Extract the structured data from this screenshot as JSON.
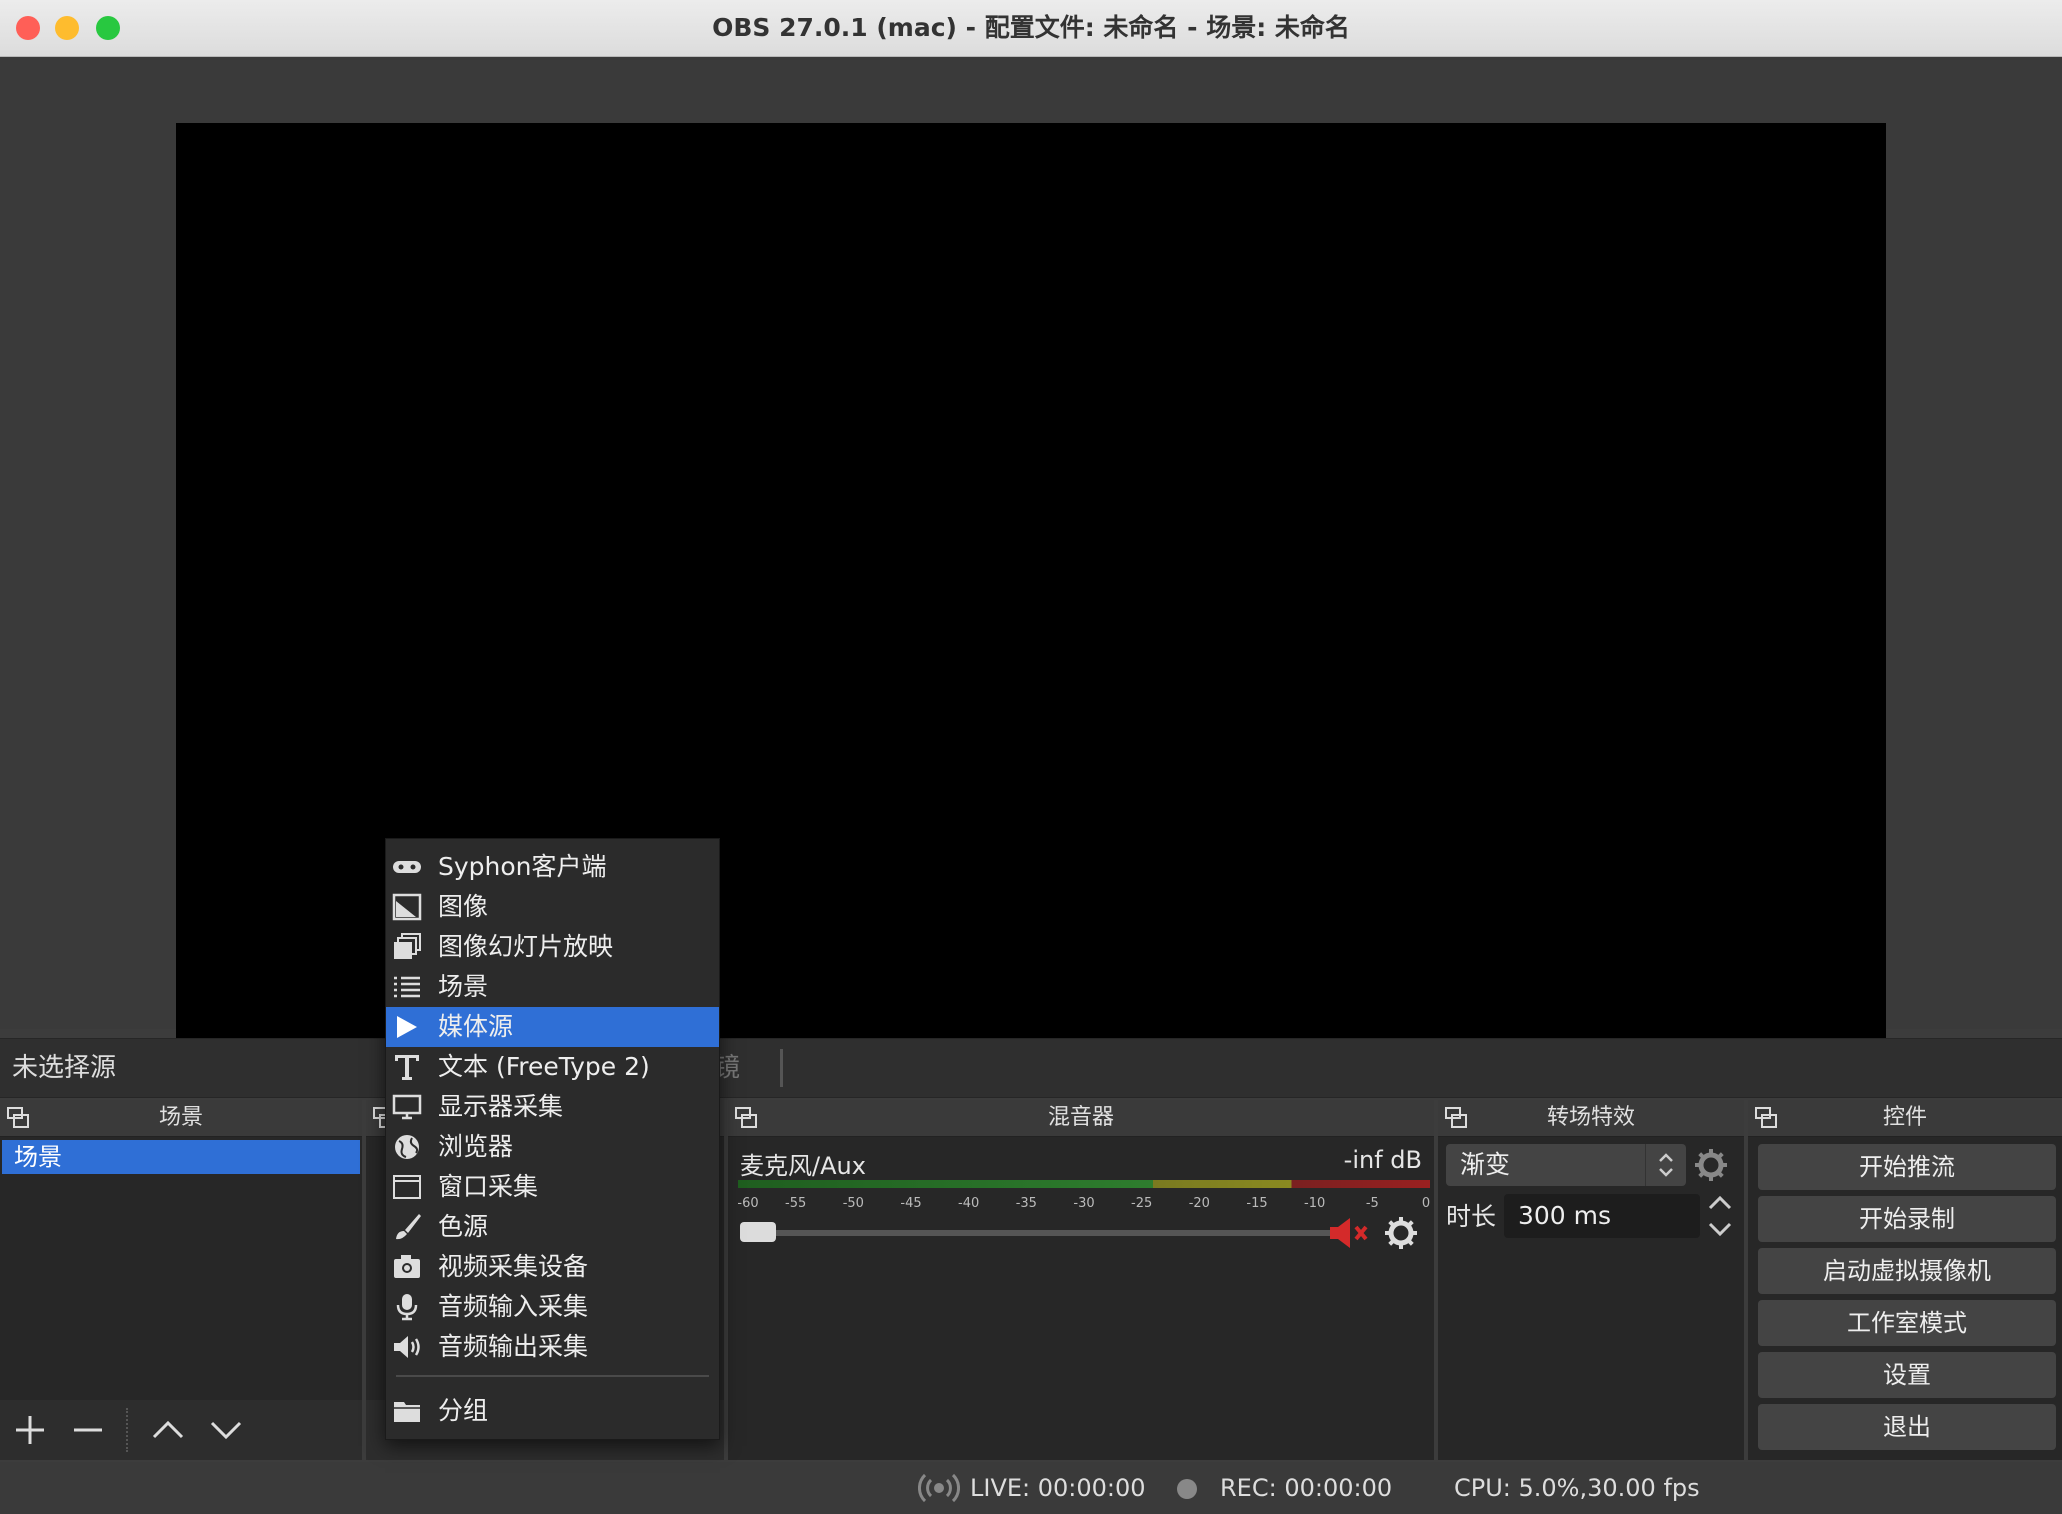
{
  "window": {
    "title": "OBS 27.0.1 (mac) - 配置文件: 未命名 - 场景: 未命名",
    "colors": {
      "close": "#ff5f57",
      "minimize": "#febc2e",
      "zoom": "#28c840",
      "accent": "#2f6fd6"
    }
  },
  "source_bar": {
    "no_source": "未选择源",
    "filters_partial": "滤镜"
  },
  "scenes_dock": {
    "title": "场景",
    "items": [
      "场景"
    ]
  },
  "mixer_dock": {
    "title": "混音器",
    "channel": {
      "name": "麦克风/Aux",
      "level": "-inf dB",
      "volume": 0.0,
      "muted": true
    },
    "ticks": [
      "-60",
      "-55",
      "-50",
      "-45",
      "-40",
      "-35",
      "-30",
      "-25",
      "-20",
      "-15",
      "-10",
      "-5",
      "0"
    ]
  },
  "transitions_dock": {
    "title": "转场特效",
    "selected": "渐变",
    "duration_label": "时长",
    "duration_value": "300 ms"
  },
  "controls_dock": {
    "title": "控件",
    "buttons": [
      "开始推流",
      "开始录制",
      "启动虚拟摄像机",
      "工作室模式",
      "设置",
      "退出"
    ]
  },
  "context_menu": {
    "items": [
      {
        "label": "Syphon客户端",
        "icon": "gamepad-icon"
      },
      {
        "label": "图像",
        "icon": "image-icon"
      },
      {
        "label": "图像幻灯片放映",
        "icon": "slideshow-icon"
      },
      {
        "label": "场景",
        "icon": "list-icon"
      },
      {
        "label": "媒体源",
        "icon": "play-icon",
        "selected": true
      },
      {
        "label": "文本 (FreeType 2)",
        "icon": "text-icon"
      },
      {
        "label": "显示器采集",
        "icon": "monitor-icon"
      },
      {
        "label": "浏览器",
        "icon": "globe-icon"
      },
      {
        "label": "窗口采集",
        "icon": "window-icon"
      },
      {
        "label": "色源",
        "icon": "brush-icon"
      },
      {
        "label": "视频采集设备",
        "icon": "camera-icon"
      },
      {
        "label": "音频输入采集",
        "icon": "microphone-icon"
      },
      {
        "label": "音频输出采集",
        "icon": "speaker-icon"
      }
    ],
    "group": {
      "label": "分组",
      "icon": "folder-icon"
    }
  },
  "status_bar": {
    "live": "LIVE: 00:00:00",
    "rec": "REC: 00:00:00",
    "cpu": "CPU: 5.0%,30.00 fps"
  }
}
